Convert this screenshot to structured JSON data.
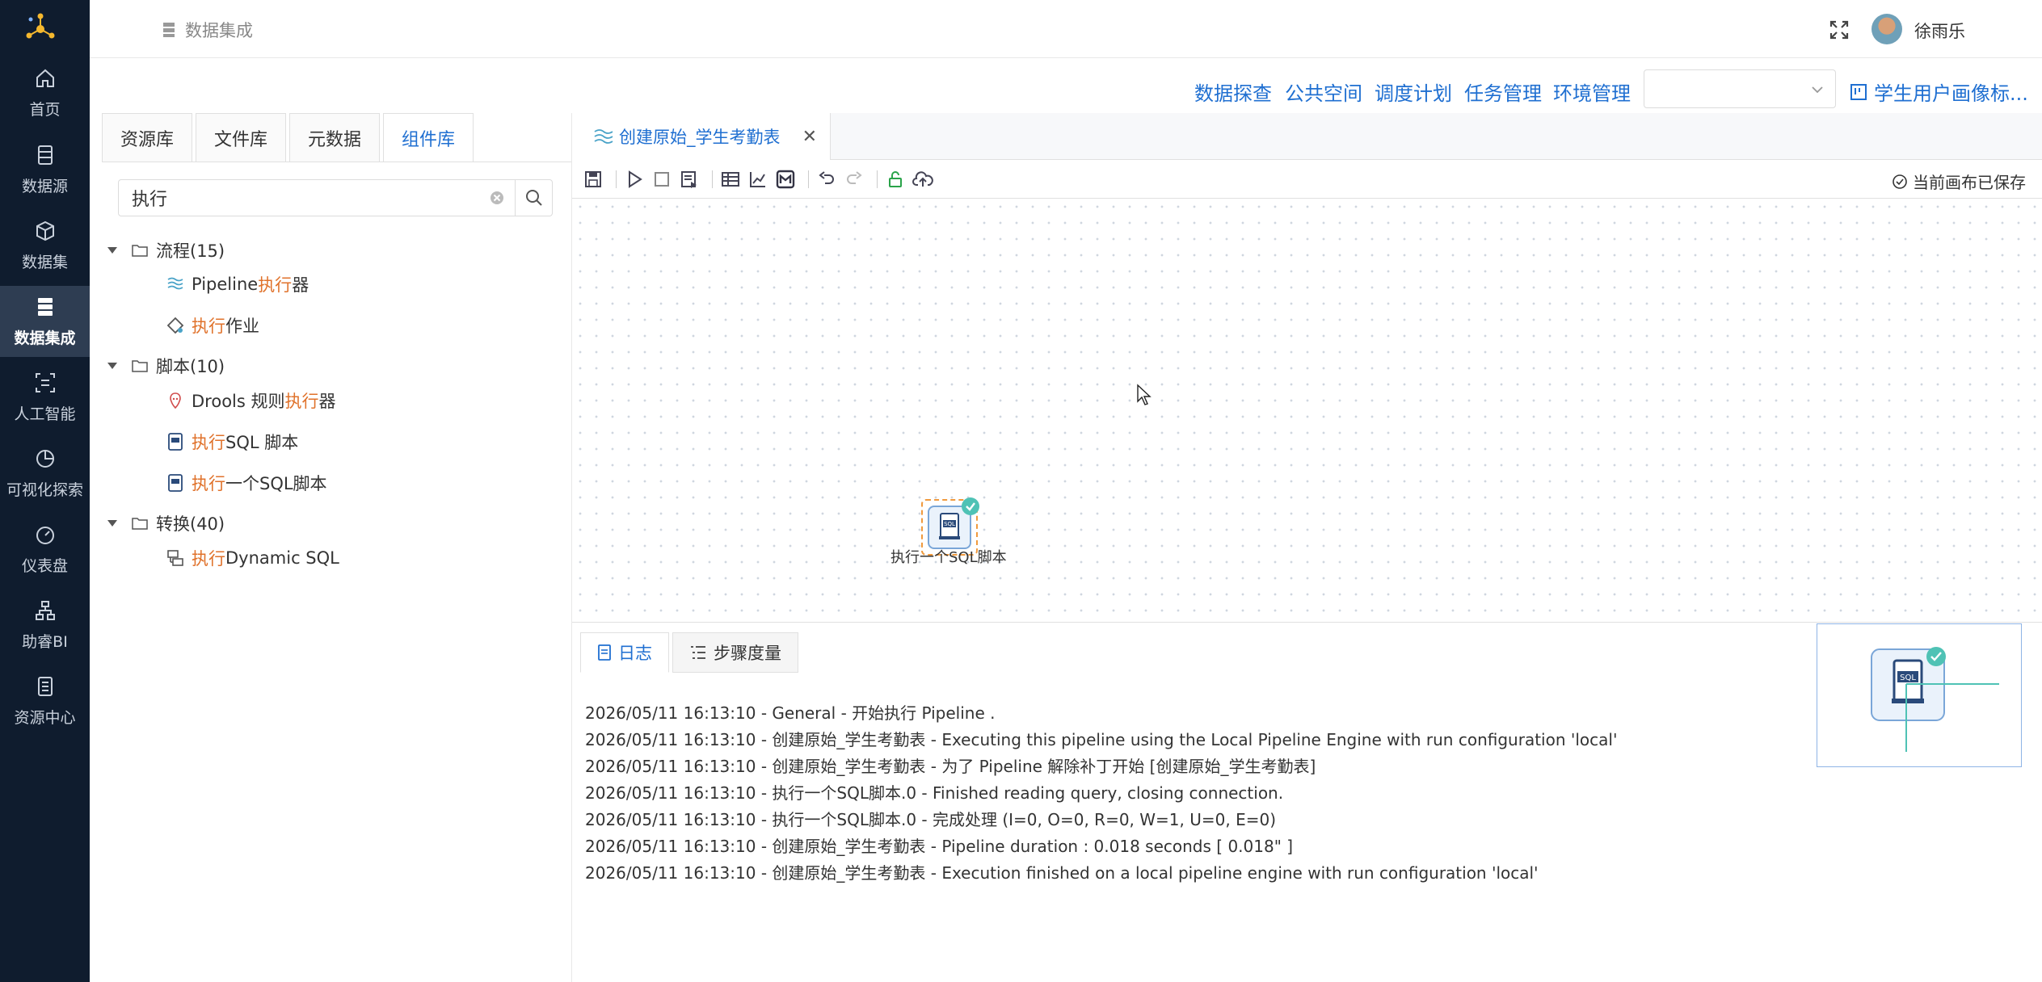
{
  "nav": {
    "items": [
      {
        "label": "首页",
        "icon": "home-icon"
      },
      {
        "label": "数据源",
        "icon": "datasource-icon"
      },
      {
        "label": "数据集",
        "icon": "dataset-icon"
      },
      {
        "label": "数据集成",
        "icon": "data-integration-icon",
        "active": true
      },
      {
        "label": "人工智能",
        "icon": "ai-icon"
      },
      {
        "label": "可视化探索",
        "icon": "visual-explore-icon"
      },
      {
        "label": "仪表盘",
        "icon": "dashboard-icon"
      },
      {
        "label": "助睿BI",
        "icon": "bi-icon"
      },
      {
        "label": "资源中心",
        "icon": "resource-center-icon"
      }
    ]
  },
  "header": {
    "breadcrumb": "数据集成",
    "username": "徐雨乐"
  },
  "menubar": {
    "links": [
      "数据探查",
      "公共空间",
      "调度计划",
      "任务管理",
      "环境管理"
    ],
    "env_select_value": "",
    "project": "学生用户画像标..."
  },
  "library": {
    "tabs": [
      "资源库",
      "文件库",
      "元数据",
      "组件库"
    ],
    "active_tab": "组件库",
    "search_value": "执行",
    "tree": [
      {
        "group": "流程(15)",
        "items": [
          {
            "pre": "Pipeline ",
            "hl": "执行",
            "post": " 器",
            "icon": "pipeline-icon"
          },
          {
            "pre": "",
            "hl": "执行",
            "post": " 作业",
            "icon": "job-icon"
          }
        ]
      },
      {
        "group": "脚本(10)",
        "items": [
          {
            "pre": "Drools 规则 ",
            "hl": "执行",
            "post": " 器",
            "icon": "drools-icon"
          },
          {
            "pre": "",
            "hl": "执行",
            "post": " SQL 脚本",
            "icon": "sql-script-icon"
          },
          {
            "pre": "",
            "hl": "执行",
            "post": " 一个SQL脚本",
            "icon": "sql-script-icon"
          }
        ]
      },
      {
        "group": "转换(40)",
        "items": [
          {
            "pre": "",
            "hl": "执行",
            "post": " Dynamic SQL",
            "icon": "dynamic-sql-icon"
          }
        ]
      }
    ]
  },
  "editor": {
    "tab_title": "创建原始_学生考勤表",
    "saved_status": "当前画布已保存",
    "node_label": "执行一个SQL脚本"
  },
  "log": {
    "tabs": [
      "日志",
      "步骤度量"
    ],
    "lines": [
      "2026/05/11 16:13:10 - General - 开始执行 Pipeline .",
      "2026/05/11 16:13:10 - 创建原始_学生考勤表 - Executing this pipeline using the Local Pipeline Engine with run configuration 'local'",
      "2026/05/11 16:13:10 - 创建原始_学生考勤表 - 为了 Pipeline 解除补丁开始 [创建原始_学生考勤表]",
      "2026/05/11 16:13:10 - 执行一个SQL脚本.0 - Finished reading query, closing connection.",
      "2026/05/11 16:13:10 - 执行一个SQL脚本.0 - 完成处理 (I=0, O=0, R=0, W=1, U=0, E=0)",
      "2026/05/11 16:13:10 - 创建原始_学生考勤表 - Pipeline duration : 0.018 seconds [  0.018\" ]",
      "2026/05/11 16:13:10 - 创建原始_学生考勤表 - Execution finished on a local pipeline engine with run configuration 'local'"
    ]
  },
  "colors": {
    "nav_bg": "#0f1c2e",
    "accent": "#1f6fd1",
    "highlight": "#e0722b",
    "node_check": "#4fc2b5"
  }
}
